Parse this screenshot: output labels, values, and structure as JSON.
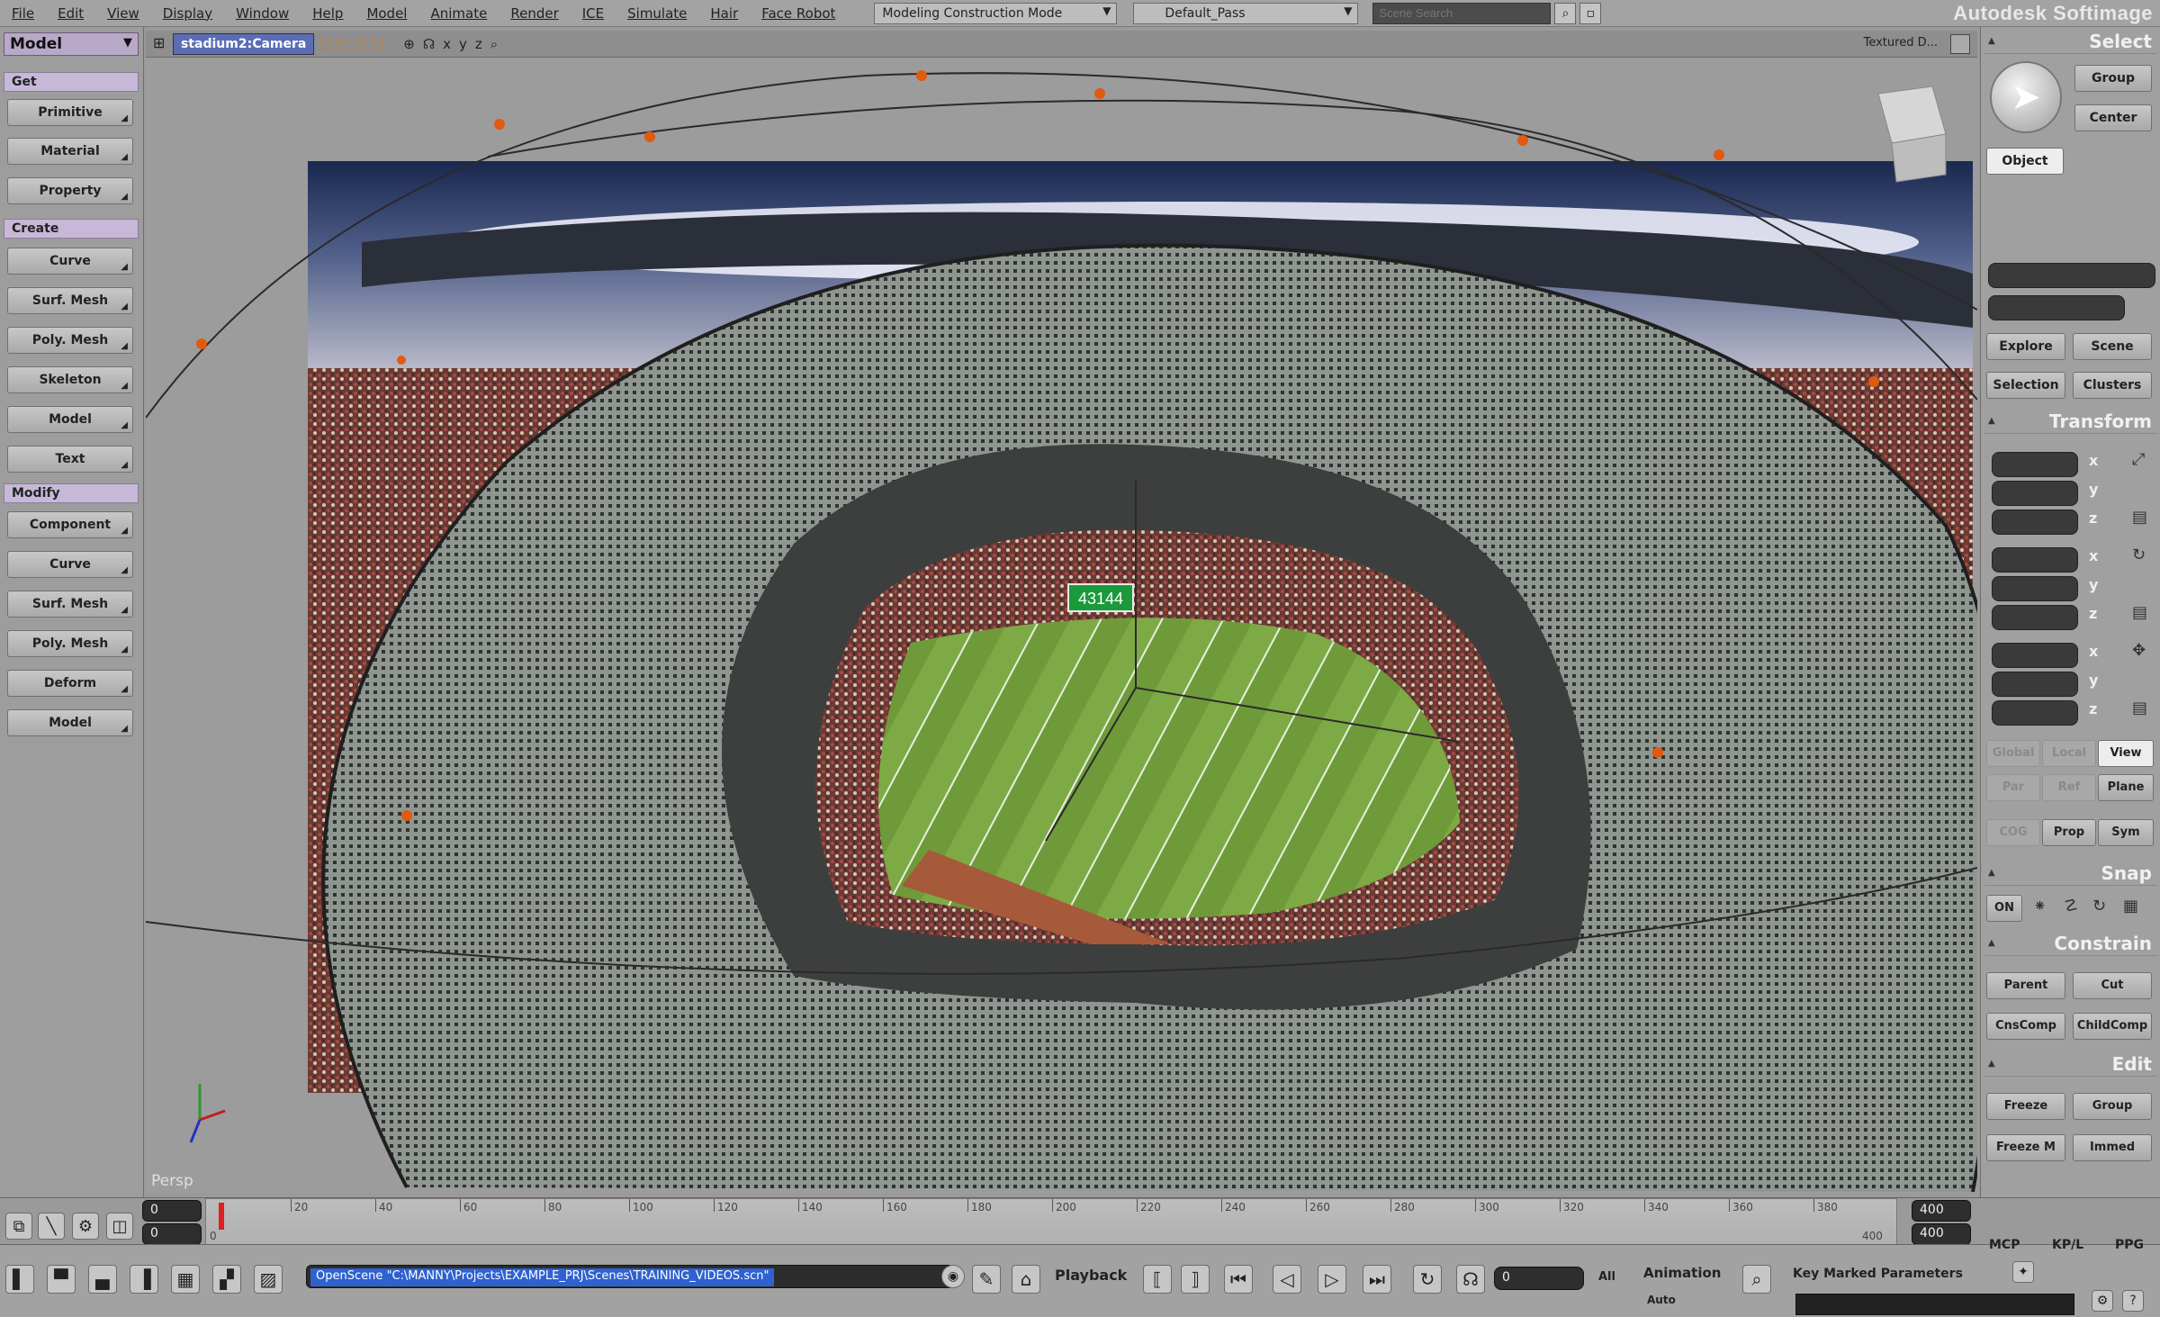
{
  "menubar": {
    "menus": [
      "File",
      "Edit",
      "View",
      "Display",
      "Window",
      "Help",
      "Model",
      "Animate",
      "Render",
      "ICE",
      "Simulate",
      "Hair",
      "Face Robot"
    ],
    "mode_dropdown": "Modeling Construction Mode",
    "pass_dropdown": "Default_Pass",
    "search_placeholder": "Scene Search",
    "brand": "Autodesk Softimage"
  },
  "left_panel": {
    "mode": "Model",
    "get_label": "Get",
    "get_items": [
      "Primitive",
      "Material",
      "Property"
    ],
    "create_label": "Create",
    "create_items": [
      "Curve",
      "Surf. Mesh",
      "Poly. Mesh",
      "Skeleton",
      "Model",
      "Text"
    ],
    "modify_label": "Modify",
    "modify_items": [
      "Component",
      "Curve",
      "Surf. Mesh",
      "Poly. Mesh",
      "Deform",
      "Model"
    ]
  },
  "viewport": {
    "camera": "stadium2:Camera",
    "shading": "Textured D...",
    "view_label": "Persp",
    "scoreboard": "43144"
  },
  "right_panel": {
    "select_label": "Select",
    "group_btn": "Group",
    "center_btn": "Center",
    "object_btn": "Object",
    "explore_btn": "Explore",
    "scene_btn": "Scene",
    "selection_btn": "Selection",
    "clusters_btn": "Clusters",
    "transform_label": "Transform",
    "axes": [
      "x",
      "y",
      "z"
    ],
    "global_btn": "Global",
    "local_btn": "Local",
    "view_btn": "View",
    "par_btn": "Par",
    "ref_btn": "Ref",
    "plane_btn": "Plane",
    "cog_btn": "COG",
    "prop_btn": "Prop",
    "sym_btn": "Sym",
    "snap_label": "Snap",
    "snap_on": "ON",
    "constrain_label": "Constrain",
    "parent_btn": "Parent",
    "cut_btn": "Cut",
    "cnscomp_btn": "CnsComp",
    "childcomp_btn": "ChildComp",
    "edit_label": "Edit",
    "freeze_btn": "Freeze",
    "group2_btn": "Group",
    "freezem_btn": "Freeze M",
    "immed_btn": "Immed"
  },
  "timeline": {
    "start": "0",
    "start2": "0",
    "end": "400",
    "end2": "400",
    "end_left": "400",
    "ticks": [
      "0",
      "20",
      "40",
      "60",
      "80",
      "100",
      "120",
      "140",
      "160",
      "180",
      "200",
      "220",
      "240",
      "260",
      "280",
      "300",
      "320",
      "340",
      "360",
      "380"
    ]
  },
  "bottombar": {
    "command": "OpenScene \"C:\\MANNY\\Projects\\EXAMPLE_PRJ\\Scenes\\TRAINING_VIDEOS.scn\"",
    "playback_label": "Playback",
    "current_frame": "0",
    "all_label": "All",
    "animation_label": "Animation",
    "auto_label": "Auto",
    "key_params": "Key Marked Parameters",
    "mcp": "MCP",
    "kpl": "KP/L",
    "ppg": "PPG"
  }
}
